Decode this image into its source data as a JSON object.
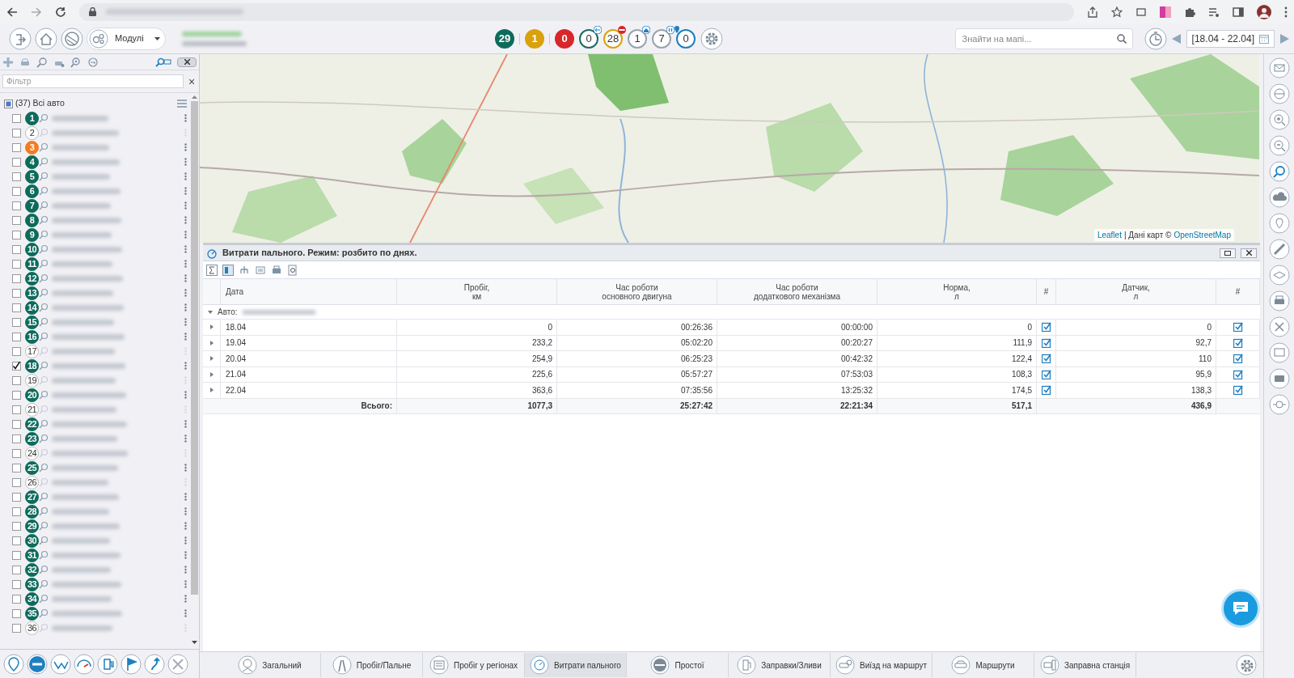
{
  "toolbar": {
    "modules_label": "Модулі",
    "counters": [
      {
        "kind": "solid",
        "value": "29",
        "color": "#0e6b5c"
      },
      {
        "kind": "solid",
        "value": "1",
        "color": "#d9a20b"
      },
      {
        "kind": "solid",
        "value": "0",
        "color": "#d9262b"
      },
      {
        "kind": "ring",
        "value": "0",
        "color": "#1e6b63"
      },
      {
        "kind": "ring",
        "value": "28",
        "color": "#d9a20b"
      },
      {
        "kind": "ring",
        "value": "1",
        "color": "#9aa3ad"
      },
      {
        "kind": "ring",
        "value": "7",
        "color": "#9aa3ad"
      },
      {
        "kind": "ring",
        "value": "0",
        "color": "#1f7fc1"
      }
    ],
    "search": {
      "placeholder": "Знайти на мапі..."
    },
    "date_range": "[18.04 - 22.04]"
  },
  "sidebar": {
    "filter": {
      "placeholder": "Фільтр"
    },
    "filter_clear": "×",
    "all_label": "(37) Всі авто",
    "all_partial": true,
    "vehicles": [
      {
        "number": "1",
        "online": true,
        "color": "#0e6b5c",
        "checked": false
      },
      {
        "number": "2",
        "online": false,
        "checked": false
      },
      {
        "number": "3",
        "online": true,
        "color": "#f07d22",
        "checked": false
      },
      {
        "number": "4",
        "online": true,
        "color": "#0e6b5c",
        "checked": false
      },
      {
        "number": "5",
        "online": true,
        "color": "#0e6b5c",
        "checked": false
      },
      {
        "number": "6",
        "online": true,
        "color": "#0e6b5c",
        "checked": false
      },
      {
        "number": "7",
        "online": true,
        "color": "#0e6b5c",
        "checked": false
      },
      {
        "number": "8",
        "online": true,
        "color": "#0e6b5c",
        "checked": false
      },
      {
        "number": "9",
        "online": true,
        "color": "#0e6b5c",
        "checked": false
      },
      {
        "number": "10",
        "online": true,
        "color": "#0e6b5c",
        "checked": false
      },
      {
        "number": "11",
        "online": true,
        "color": "#0e6b5c",
        "checked": false
      },
      {
        "number": "12",
        "online": true,
        "color": "#0e6b5c",
        "checked": false
      },
      {
        "number": "13",
        "online": true,
        "color": "#0e6b5c",
        "checked": false
      },
      {
        "number": "14",
        "online": true,
        "color": "#0e6b5c",
        "checked": false
      },
      {
        "number": "15",
        "online": true,
        "color": "#0e6b5c",
        "checked": false
      },
      {
        "number": "16",
        "online": true,
        "color": "#0e6b5c",
        "checked": false
      },
      {
        "number": "17",
        "online": false,
        "checked": false
      },
      {
        "number": "18",
        "online": true,
        "color": "#0e6b5c",
        "checked": true
      },
      {
        "number": "19",
        "online": false,
        "checked": false
      },
      {
        "number": "20",
        "online": true,
        "color": "#0e6b5c",
        "checked": false
      },
      {
        "number": "21",
        "online": false,
        "checked": false
      },
      {
        "number": "22",
        "online": true,
        "color": "#0e6b5c",
        "checked": false
      },
      {
        "number": "23",
        "online": true,
        "color": "#0e6b5c",
        "checked": false
      },
      {
        "number": "24",
        "online": false,
        "checked": false
      },
      {
        "number": "25",
        "online": true,
        "color": "#0e6b5c",
        "checked": false
      },
      {
        "number": "26",
        "online": false,
        "checked": false
      },
      {
        "number": "27",
        "online": true,
        "color": "#0e6b5c",
        "checked": false
      },
      {
        "number": "28",
        "online": true,
        "color": "#0e6b5c",
        "checked": false
      },
      {
        "number": "29",
        "online": true,
        "color": "#0e6b5c",
        "checked": false
      },
      {
        "number": "30",
        "online": true,
        "color": "#0e6b5c",
        "checked": false
      },
      {
        "number": "31",
        "online": true,
        "color": "#0e6b5c",
        "checked": false
      },
      {
        "number": "32",
        "online": true,
        "color": "#0e6b5c",
        "checked": false
      },
      {
        "number": "33",
        "online": true,
        "color": "#0e6b5c",
        "checked": false
      },
      {
        "number": "34",
        "online": true,
        "color": "#0e6b5c",
        "checked": false
      },
      {
        "number": "35",
        "online": true,
        "color": "#0e6b5c",
        "checked": false
      },
      {
        "number": "36",
        "online": false,
        "checked": false
      }
    ]
  },
  "map": {
    "kind": "picture",
    "attribution_link": "Leaflet",
    "attribution_text": "| Дані карт ©",
    "attribution_osm": "OpenStreetMap"
  },
  "report": {
    "title": "Витрати пального. Режим: розбито по днях.",
    "columns": [
      "Дата",
      "Пробіг,\nкм",
      "Час роботи\nосновного двигуна",
      "Час роботи\nдодаткового механізма",
      "Норма,\nл",
      "#",
      "Датчик,\nл",
      "#"
    ],
    "group_label": "Авто:",
    "rows": [
      {
        "date": "18.04",
        "mileage": "0",
        "engine": "00:26:36",
        "extra": "00:00:00",
        "norm": "0",
        "norm_checked": true,
        "sensor": "0",
        "sensor_checked": true
      },
      {
        "date": "19.04",
        "mileage": "233,2",
        "engine": "05:02:20",
        "extra": "00:20:27",
        "norm": "111,9",
        "norm_checked": true,
        "sensor": "92,7",
        "sensor_checked": true
      },
      {
        "date": "20.04",
        "mileage": "254,9",
        "engine": "06:25:23",
        "extra": "00:42:32",
        "norm": "122,4",
        "norm_checked": true,
        "sensor": "110",
        "sensor_checked": true
      },
      {
        "date": "21.04",
        "mileage": "225,6",
        "engine": "05:57:27",
        "extra": "07:53:03",
        "norm": "108,3",
        "norm_checked": true,
        "sensor": "95,9",
        "sensor_checked": true
      },
      {
        "date": "22.04",
        "mileage": "363,6",
        "engine": "07:35:56",
        "extra": "13:25:32",
        "norm": "174,5",
        "norm_checked": true,
        "sensor": "138,3",
        "sensor_checked": true
      }
    ],
    "totals": {
      "label": "Всього:",
      "mileage": "1077,3",
      "engine": "25:27:42",
      "extra": "22:21:34",
      "norm": "517,1",
      "sensor": "436,9"
    }
  },
  "bottom_tabs": [
    {
      "label": "Загальний",
      "selected": false
    },
    {
      "label": "Пробіг/Пальне",
      "selected": false
    },
    {
      "label": "Пробіг у регіонах",
      "selected": false
    },
    {
      "label": "Витрати пального",
      "selected": true
    },
    {
      "label": "Простої",
      "selected": false
    },
    {
      "label": "Заправки/Зливи",
      "selected": false
    },
    {
      "label": "Виїзд на маршрут",
      "selected": false
    },
    {
      "label": "Маршрути",
      "selected": false
    },
    {
      "label": "Заправна станція",
      "selected": false
    }
  ]
}
